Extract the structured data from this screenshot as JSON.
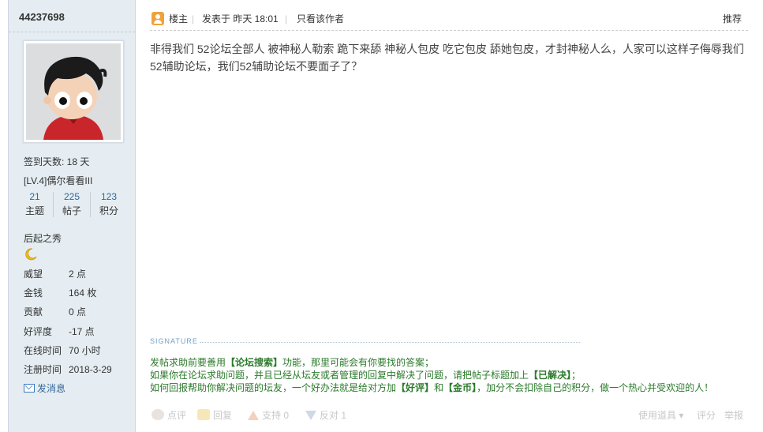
{
  "user": {
    "username": "44237698",
    "stats": {
      "signin_days": "签到天数: 18 天",
      "level": "[LV.4]偶尔看看III"
    },
    "counts": [
      {
        "value": "21",
        "label": "主题"
      },
      {
        "value": "225",
        "label": "帖子"
      },
      {
        "value": "123",
        "label": "积分"
      }
    ],
    "title": "后起之秀",
    "medal_icon": "crescent-moon-icon",
    "info": [
      {
        "key": "威望",
        "value": "2 点"
      },
      {
        "key": "金钱",
        "value": "164 枚"
      },
      {
        "key": "贡献",
        "value": "0 点"
      },
      {
        "key": "好评度",
        "value": "-17 点"
      },
      {
        "key": "在线时间",
        "value": "70 小时"
      },
      {
        "key": "注册时间",
        "value": "2018-3-29"
      }
    ],
    "pm_label": "发消息"
  },
  "post": {
    "author_role": "楼主",
    "posted_at": "发表于 昨天 18:01",
    "only_author": "只看该作者",
    "recommend": "推荐",
    "content": "非得我们  52论坛全部人  被神秘人勒索  跪下来舔  神秘人包皮    吃它包皮  舔她包皮，才封神秘人么，人家可以这样子侮辱我们52辅助论坛，我们52辅助论坛不要面子了？"
  },
  "signature": {
    "label": "SIGNATURE",
    "line1": {
      "pre": "发帖求助前要善用",
      "b1": "【论坛搜索】",
      "post": "功能，那里可能会有你要找的答案；"
    },
    "line2": {
      "pre": "如果你在论坛求助问题，并且已经从坛友或者管理的回复中解决了问题，请把帖子标题加上",
      "b1": "【已解决】",
      "post": "；"
    },
    "line3": {
      "pre": "如何回报帮助你解决问题的坛友，一个好办法就是给对方加",
      "b1": "【好评】",
      "mid": "和",
      "b2": "【金币】",
      "post": "，加分不会扣除自己的积分，做一个热心并受欢迎的人！"
    }
  },
  "actions": {
    "comment": "点评",
    "reply": "回复",
    "support": "支持 0",
    "oppose": "反对 1",
    "tools": "使用道具 ▾",
    "rate": "评分",
    "report": "举报"
  },
  "colors": {
    "sidebar_bg": "#e5edf2",
    "link_blue": "#336699",
    "signature_green": "#2b7a2b"
  }
}
